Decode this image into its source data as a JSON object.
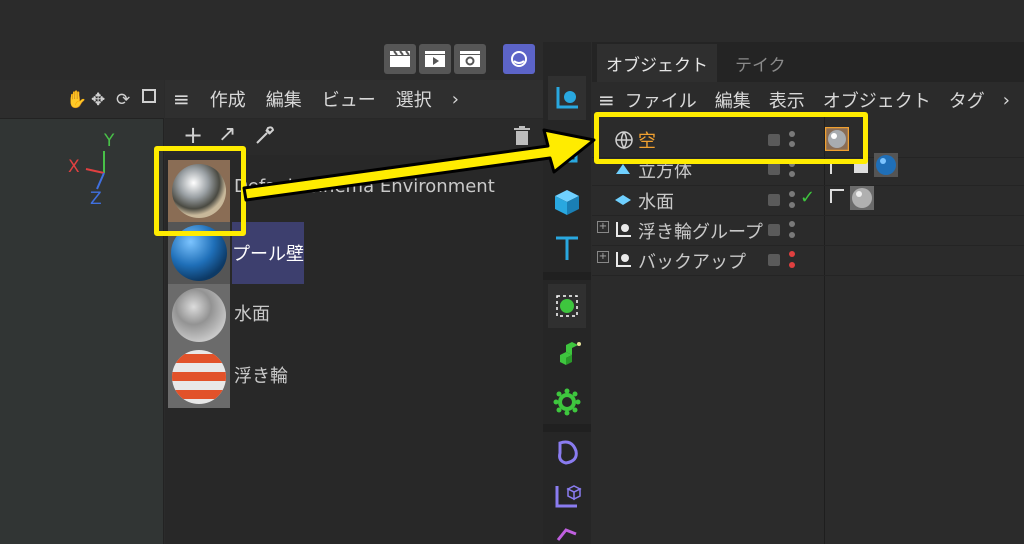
{
  "materials_panel": {
    "menu": {
      "hamburger": "≡",
      "create": "作成",
      "edit": "編集",
      "view": "ビュー",
      "select": "選択",
      "more": "›"
    },
    "toolbar": {
      "add": "+",
      "arrow": "↗"
    },
    "materials": [
      {
        "label": "Default Cinema Environment",
        "thumb": "chrome-sphere"
      },
      {
        "label": "プール壁",
        "thumb": "blue-sphere"
      },
      {
        "label": "水面",
        "thumb": "glass-sphere"
      },
      {
        "label": "浮き輪",
        "thumb": "striped-sphere"
      }
    ]
  },
  "viewport": {
    "axis": {
      "y": "Y",
      "x": "X",
      "z": "Z"
    }
  },
  "objects_panel": {
    "tabs": [
      {
        "label": "オブジェクト"
      },
      {
        "label": "テイク"
      }
    ],
    "menu": {
      "hamburger": "≡",
      "file": "ファイル",
      "edit": "編集",
      "view": "表示",
      "object": "オブジェクト",
      "tag": "タグ",
      "more": "›"
    },
    "rows": [
      {
        "name": "空",
        "check": ""
      },
      {
        "name": "立方体",
        "check": ""
      },
      {
        "name": "水面",
        "check": "✓"
      },
      {
        "name": "浮き輪グループ",
        "check": ""
      },
      {
        "name": "バックアップ",
        "check": ""
      }
    ]
  },
  "colors": {
    "highlight": "#ffec00",
    "selected_object": "#f0a030",
    "accent_blue": "#29a8e0",
    "accent_green": "#3ec63e",
    "selection_bg": "#3d3f6e"
  }
}
